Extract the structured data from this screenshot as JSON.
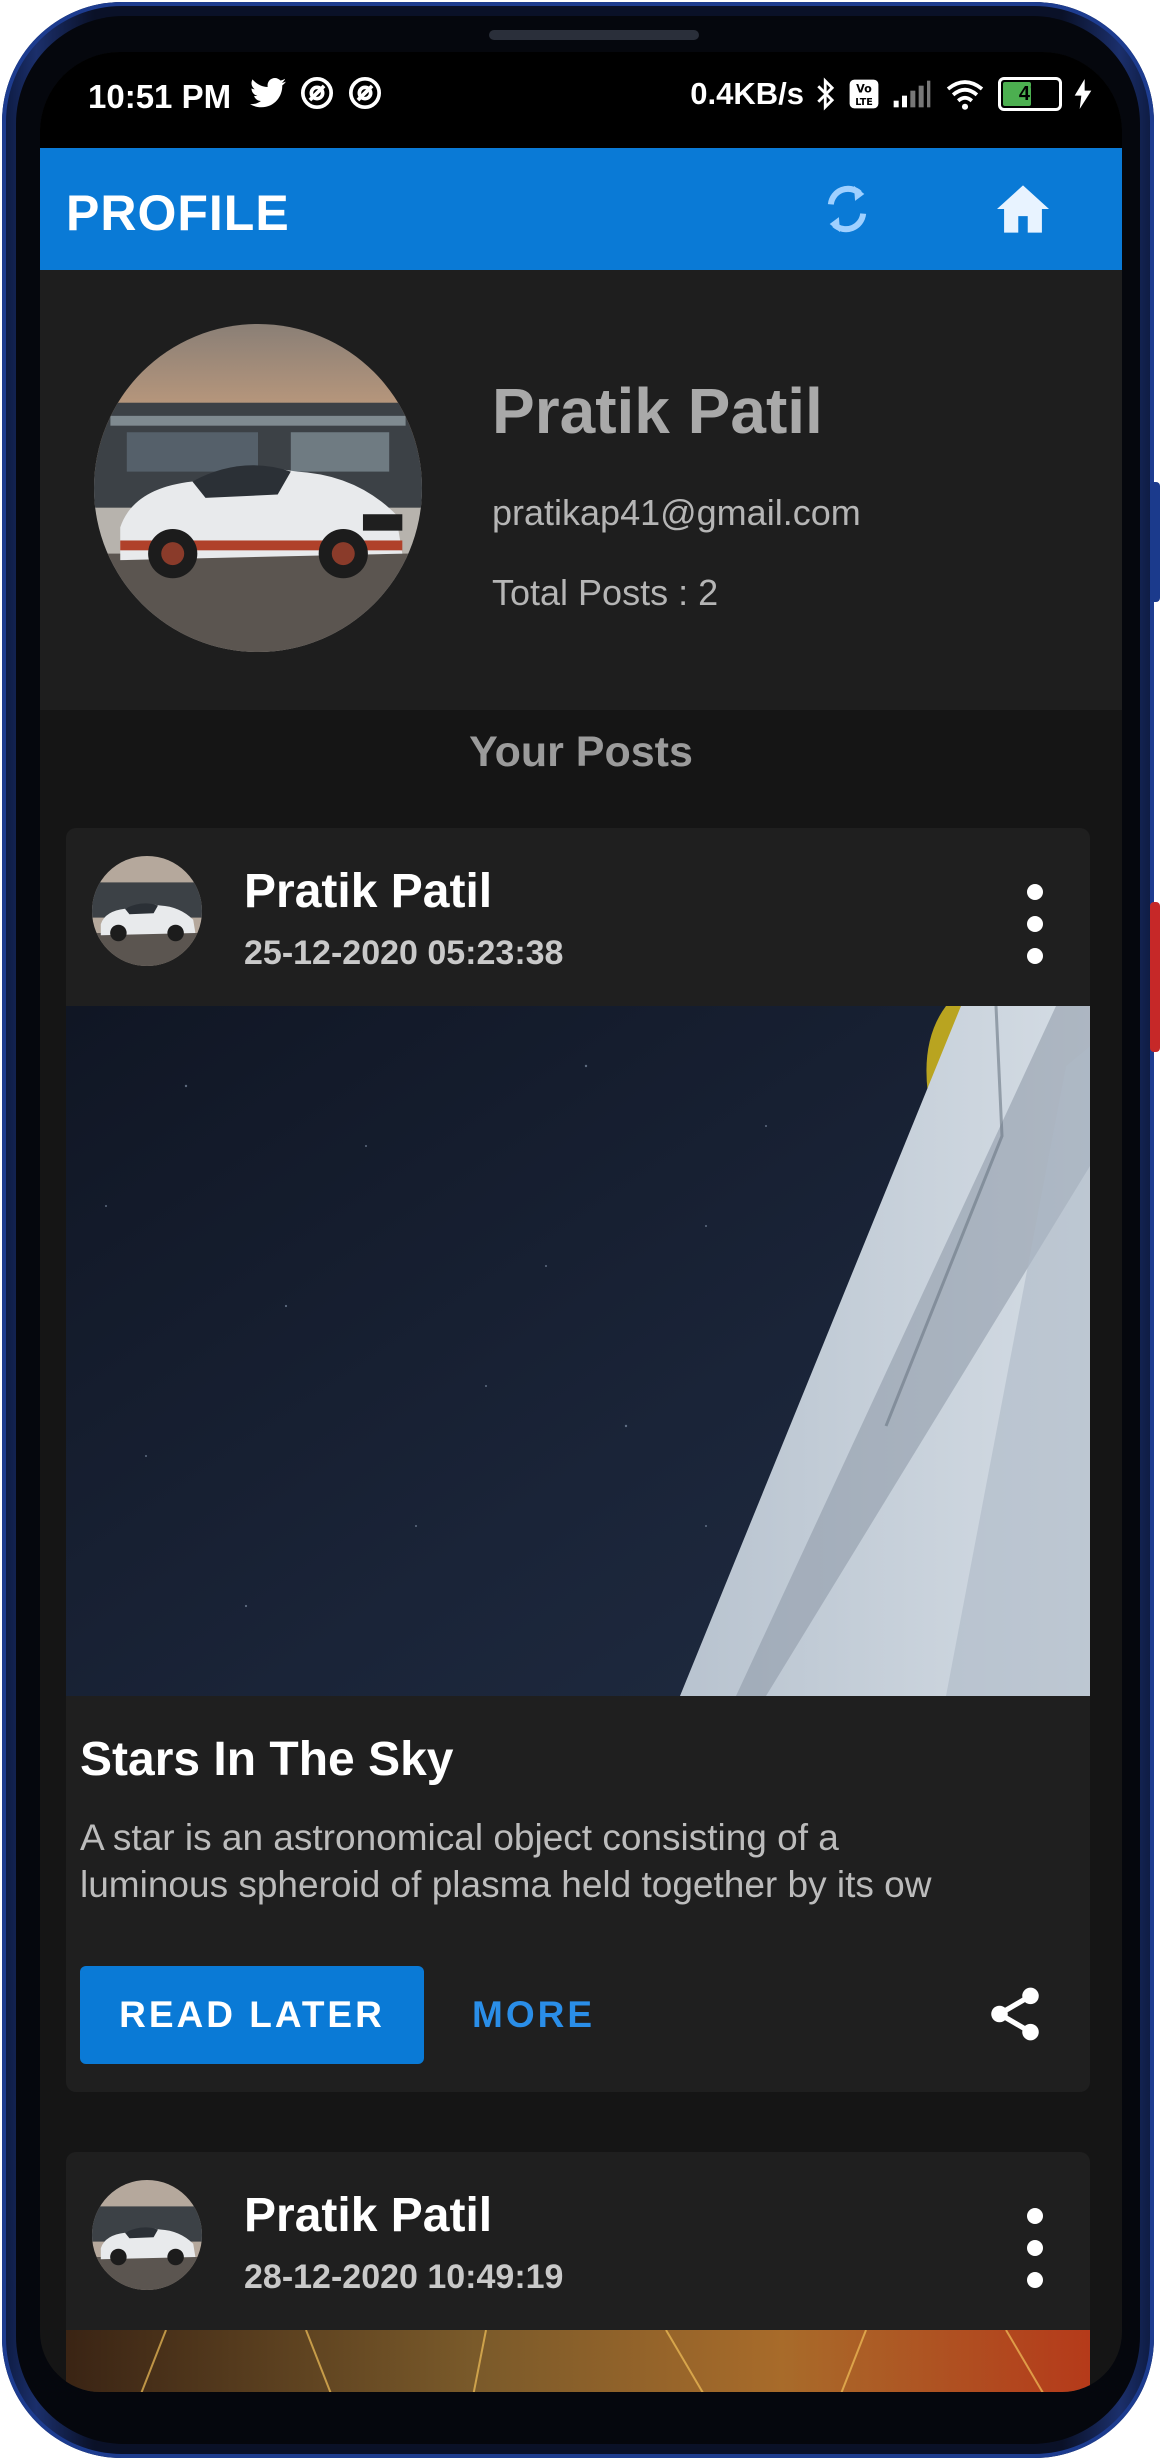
{
  "status_bar": {
    "time": "10:51 PM",
    "net_speed": "0.4KB/s",
    "battery": "47",
    "left_icons": [
      "twitter-icon",
      "at-sign-icon",
      "at-sign-icon"
    ],
    "right_icons": [
      "bluetooth-icon",
      "volte-icon",
      "signal-icon",
      "wifi-icon",
      "battery-icon",
      "charging-icon"
    ]
  },
  "appbar": {
    "title": "PROFILE",
    "actions": [
      "refresh-icon",
      "home-icon"
    ],
    "color": "#0a7ad6"
  },
  "profile": {
    "name": "Pratik Patil",
    "email": "pratikap41@gmail.com",
    "total_posts": "Total Posts : 2"
  },
  "section_title": "Your Posts",
  "posts": [
    {
      "author": "Pratik Patil",
      "date": "25-12-2020 05:23:38",
      "title": "Stars In The Sky",
      "body_line1": "A star is an astronomical object consisting of a",
      "body_line2": "luminous spheroid of plasma held together by its ow",
      "read_later": "READ LATER",
      "more": "MORE"
    },
    {
      "author": "Pratik Patil",
      "date": "28-12-2020 10:49:19"
    }
  ],
  "colors": {
    "background": "#151515",
    "card": "#1f1f1f",
    "accent": "#0a7ad6",
    "link": "#2a8ee8"
  }
}
